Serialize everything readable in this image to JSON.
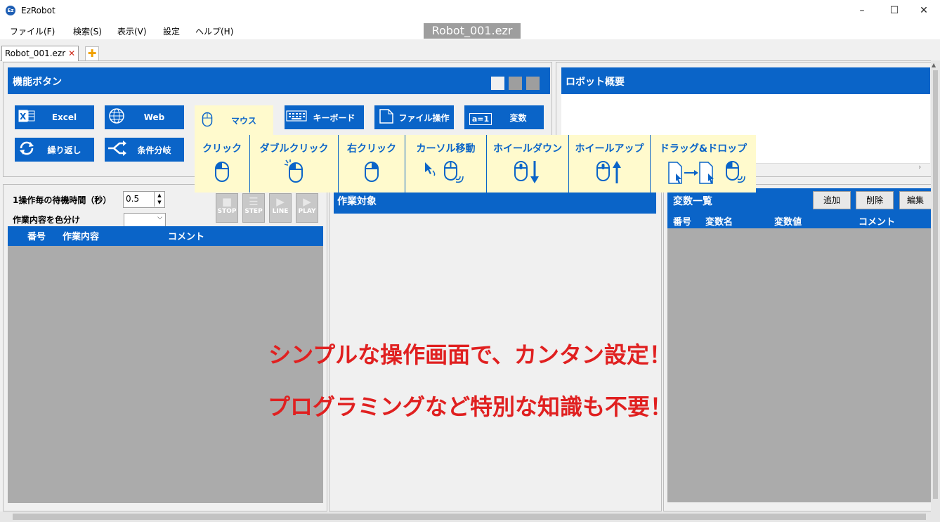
{
  "window": {
    "app_title": "EzRobot",
    "app_icon_text": "Ez",
    "doc_title": "Robot_001.ezr",
    "controls": {
      "minimize": "–",
      "maximize": "☐",
      "close": "✕"
    }
  },
  "menu": [
    "ファイル(F)",
    "検索(S)",
    "表示(V)",
    "設定",
    "ヘルプ(H)"
  ],
  "tabs": {
    "active": "Robot_001.ezr",
    "close_glyph": "✕",
    "add_glyph": "✚"
  },
  "func_panel": {
    "title": "機能ボタン",
    "buttons": [
      {
        "label": "Excel",
        "icon": "excel-icon"
      },
      {
        "label": "Web",
        "icon": "globe-icon"
      },
      {
        "label": "マウス",
        "icon": "mouse-icon"
      },
      {
        "label": "キーボード",
        "icon": "keyboard-icon"
      },
      {
        "label": "ファイル操作",
        "icon": "file-icon"
      },
      {
        "label": "変数",
        "icon": "variable-icon",
        "icon_text": "a=1"
      },
      {
        "label": "繰り返し",
        "icon": "loop-icon"
      },
      {
        "label": "条件分岐",
        "icon": "branch-icon"
      }
    ],
    "view_toggles": [
      "#f0f0f0",
      "#9e9e9e",
      "#9e9e9e"
    ]
  },
  "mouse_menu": [
    "クリック",
    "ダブルクリック",
    "右クリック",
    "カーソル移動",
    "ホイールダウン",
    "ホイールアップ",
    "ドラッグ&ドロップ"
  ],
  "overview_panel": {
    "title": "ロボット概要"
  },
  "steps_panel": {
    "wait_label": "1操作毎の待機時間（秒）",
    "wait_value": "0.5",
    "color_label": "作業内容を色分け",
    "controls": [
      "STOP",
      "STEP",
      "LINE",
      "PLAY"
    ],
    "columns": [
      "番号",
      "作業内容",
      "コメント"
    ]
  },
  "target_panel": {
    "title": "作業対象"
  },
  "vars_panel": {
    "title": "変数一覧",
    "buttons": [
      "追加",
      "削除",
      "編集"
    ],
    "columns": [
      "番号",
      "変数名",
      "変数値",
      "コメント"
    ]
  },
  "overlay": {
    "line1": "シンプルな操作画面で、カンタン設定！",
    "line2": "プログラミングなど特別な知識も不要！",
    "color": "#e02020"
  },
  "colors": {
    "accent": "#0a64c8",
    "menu_bg": "#fffacd",
    "list_bg": "#ababab"
  }
}
